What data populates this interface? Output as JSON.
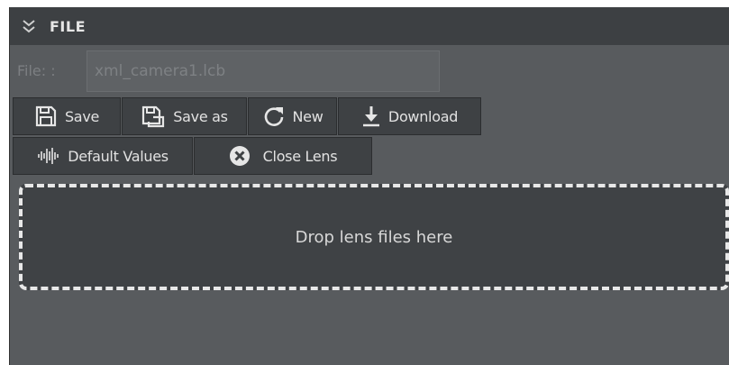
{
  "section": {
    "title": "FILE",
    "collapse_icon": "double-chevron-down-icon"
  },
  "file": {
    "label": "File: :",
    "value": "xml_camera1.lcb",
    "placeholder": "xml_camera1.lcb"
  },
  "toolbar": {
    "save_label": "Save",
    "save_as_label": "Save as",
    "new_label": "New",
    "download_label": "Download",
    "default_values_label": "Default Values",
    "close_lens_label": "Close Lens"
  },
  "icons": {
    "save": "save-icon",
    "save_as": "save-as-icon",
    "new": "refresh-icon",
    "download": "download-icon",
    "default_values": "waveform-icon",
    "close_lens": "close-circle-icon"
  },
  "dropzone": {
    "text": "Drop lens files here"
  },
  "colors": {
    "panel_bg": "#585b5e",
    "header_bg": "#3d4043",
    "button_bg": "#3e4144",
    "dropzone_bg": "#3f4245",
    "dropzone_border": "#e8e8e8"
  }
}
